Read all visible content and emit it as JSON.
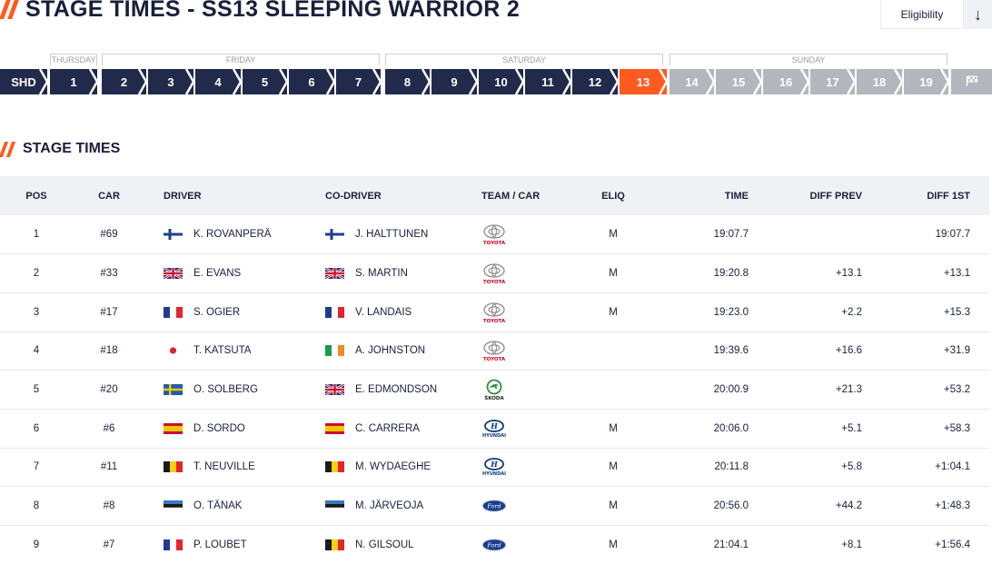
{
  "header": {
    "title": "STAGE TIMES - SS13 SLEEPING WARRIOR 2",
    "eligibility_label": "Eligibility"
  },
  "days": [
    {
      "label": "THURSDAY"
    },
    {
      "label": "FRIDAY"
    },
    {
      "label": "SATURDAY"
    },
    {
      "label": "SUNDAY"
    }
  ],
  "stages": [
    {
      "label": "SHD",
      "state": "done"
    },
    {
      "label": "1",
      "state": "done"
    },
    {
      "label": "2",
      "state": "done"
    },
    {
      "label": "3",
      "state": "done"
    },
    {
      "label": "4",
      "state": "done"
    },
    {
      "label": "5",
      "state": "done"
    },
    {
      "label": "6",
      "state": "done"
    },
    {
      "label": "7",
      "state": "done"
    },
    {
      "label": "8",
      "state": "done"
    },
    {
      "label": "9",
      "state": "done"
    },
    {
      "label": "10",
      "state": "done"
    },
    {
      "label": "11",
      "state": "done"
    },
    {
      "label": "12",
      "state": "done"
    },
    {
      "label": "13",
      "state": "current"
    },
    {
      "label": "14",
      "state": "future"
    },
    {
      "label": "15",
      "state": "future"
    },
    {
      "label": "16",
      "state": "future"
    },
    {
      "label": "17",
      "state": "future"
    },
    {
      "label": "18",
      "state": "future"
    },
    {
      "label": "19",
      "state": "future"
    },
    {
      "label": "",
      "state": "future",
      "icon": "finish-flag-icon"
    }
  ],
  "section_title": "STAGE TIMES",
  "columns": {
    "pos": "POS",
    "car": "CAR",
    "driver": "DRIVER",
    "codriver": "CO-DRIVER",
    "team": "TEAM / CAR",
    "eliq": "ELIQ",
    "time": "TIME",
    "diff_prev": "DIFF PREV",
    "diff_first": "DIFF 1ST"
  },
  "rows": [
    {
      "pos": "1",
      "car": "#69",
      "driver": "K. ROVANPERÄ",
      "driver_flag": "finland",
      "codriver": "J. HALTTUNEN",
      "codriver_flag": "finland",
      "team": "TOYOTA",
      "eliq": "M",
      "time": "19:07.7",
      "diff_prev": "",
      "diff_first": "19:07.7"
    },
    {
      "pos": "2",
      "car": "#33",
      "driver": "E. EVANS",
      "driver_flag": "uk",
      "codriver": "S. MARTIN",
      "codriver_flag": "uk",
      "team": "TOYOTA",
      "eliq": "M",
      "time": "19:20.8",
      "diff_prev": "+13.1",
      "diff_first": "+13.1"
    },
    {
      "pos": "3",
      "car": "#17",
      "driver": "S. OGIER",
      "driver_flag": "france",
      "codriver": "V. LANDAIS",
      "codriver_flag": "france",
      "team": "TOYOTA",
      "eliq": "M",
      "time": "19:23.0",
      "diff_prev": "+2.2",
      "diff_first": "+15.3"
    },
    {
      "pos": "4",
      "car": "#18",
      "driver": "T. KATSUTA",
      "driver_flag": "japan",
      "codriver": "A. JOHNSTON",
      "codriver_flag": "ireland",
      "team": "TOYOTA",
      "eliq": "",
      "time": "19:39.6",
      "diff_prev": "+16.6",
      "diff_first": "+31.9"
    },
    {
      "pos": "5",
      "car": "#20",
      "driver": "O. SOLBERG",
      "driver_flag": "sweden",
      "codriver": "E. EDMONDSON",
      "codriver_flag": "uk",
      "team": "ŠKODA",
      "eliq": "",
      "time": "20:00.9",
      "diff_prev": "+21.3",
      "diff_first": "+53.2"
    },
    {
      "pos": "6",
      "car": "#6",
      "driver": "D. SORDO",
      "driver_flag": "spain",
      "codriver": "C. CARRERA",
      "codriver_flag": "spain",
      "team": "HYUNDAI",
      "eliq": "M",
      "time": "20:06.0",
      "diff_prev": "+5.1",
      "diff_first": "+58.3"
    },
    {
      "pos": "7",
      "car": "#11",
      "driver": "T. NEUVILLE",
      "driver_flag": "belgium",
      "codriver": "M. WYDAEGHE",
      "codriver_flag": "belgium",
      "team": "HYUNDAI",
      "eliq": "M",
      "time": "20:11.8",
      "diff_prev": "+5.8",
      "diff_first": "+1:04.1"
    },
    {
      "pos": "8",
      "car": "#8",
      "driver": "O. TÄNAK",
      "driver_flag": "estonia",
      "codriver": "M. JÄRVEOJA",
      "codriver_flag": "estonia",
      "team": "FORD",
      "eliq": "M",
      "time": "20:56.0",
      "diff_prev": "+44.2",
      "diff_first": "+1:48.3"
    },
    {
      "pos": "9",
      "car": "#7",
      "driver": "P. LOUBET",
      "driver_flag": "france",
      "codriver": "N. GILSOUL",
      "codriver_flag": "belgium",
      "team": "FORD",
      "eliq": "M",
      "time": "21:04.1",
      "diff_prev": "+8.1",
      "diff_first": "+1:56.4"
    }
  ],
  "colors": {
    "navy": "#222a4b",
    "accent": "#ff5a1f",
    "future": "#b4b6bd",
    "header_bg": "#f0f1f5"
  }
}
